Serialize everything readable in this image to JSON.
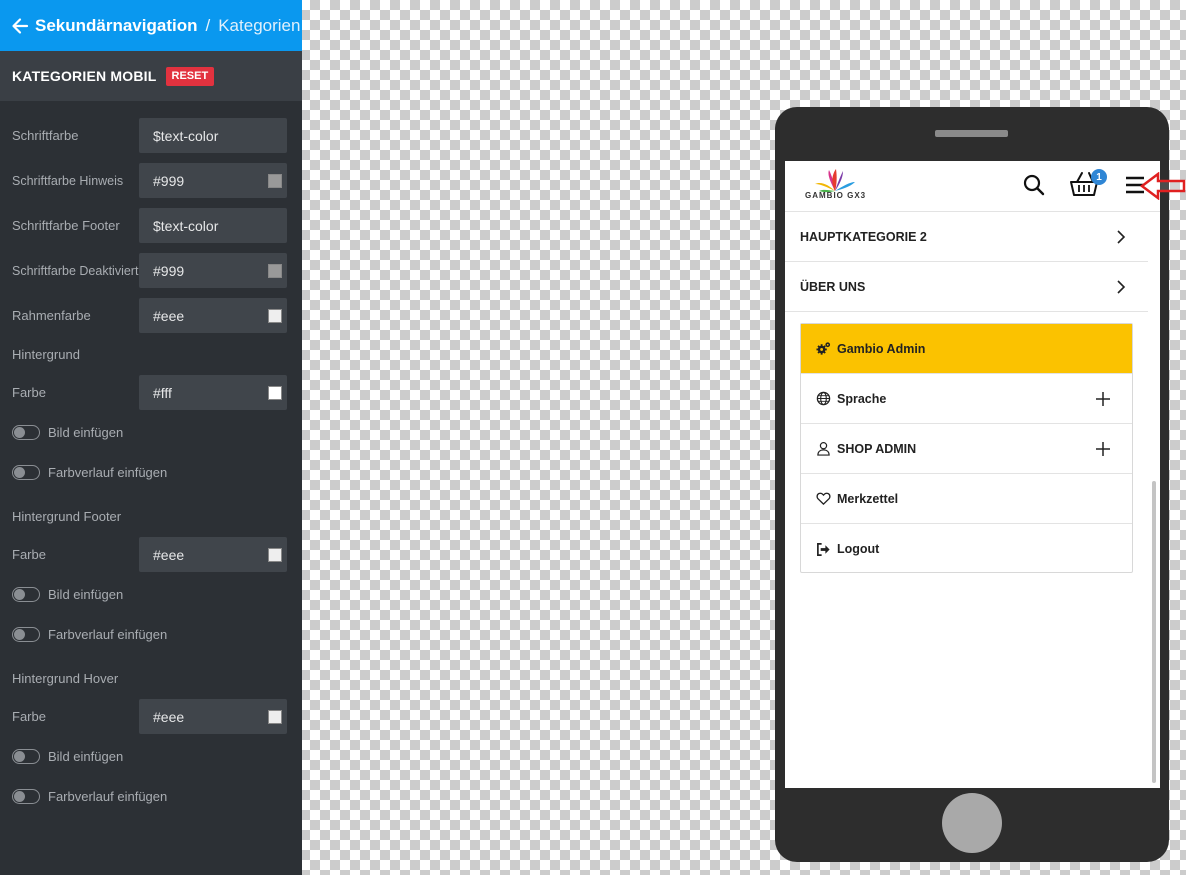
{
  "header": {
    "current": "Sekundärnavigation",
    "separator": "/",
    "next": "Kategorien"
  },
  "section": {
    "title": "KATEGORIEN MOBIL",
    "reset_label": "RESET"
  },
  "fields": {
    "schriftfarbe": {
      "label": "Schriftfarbe",
      "value": "$text-color"
    },
    "schriftfarbe_hinweis": {
      "label": "Schriftfarbe Hinweis",
      "value": "#999",
      "swatch": "#999999"
    },
    "schriftfarbe_footer": {
      "label": "Schriftfarbe Footer",
      "value": "$text-color"
    },
    "schriftfarbe_deaktiviert": {
      "label": "Schriftfarbe Deaktiviert",
      "value": "#999",
      "swatch": "#999999"
    },
    "rahmenfarbe": {
      "label": "Rahmenfarbe",
      "value": "#eee",
      "swatch": "#eeeeee"
    }
  },
  "hintergrund": {
    "title": "Hintergrund",
    "farbe_label": "Farbe",
    "farbe_value": "#fff",
    "swatch": "#ffffff",
    "bild_label": "Bild einfügen",
    "verlauf_label": "Farbverlauf einfügen"
  },
  "hintergrund_footer": {
    "title": "Hintergrund Footer",
    "farbe_label": "Farbe",
    "farbe_value": "#eee",
    "swatch": "#eeeeee",
    "bild_label": "Bild einfügen",
    "verlauf_label": "Farbverlauf einfügen"
  },
  "hintergrund_hover": {
    "title": "Hintergrund Hover",
    "farbe_label": "Farbe",
    "farbe_value": "#eee",
    "swatch": "#eeeeee",
    "bild_label": "Bild einfügen",
    "verlauf_label": "Farbverlauf einfügen"
  },
  "preview": {
    "logo_text": "GAMBIO GX3",
    "cart_count": "1",
    "categories": [
      "HAUPTKATEGORIE 2",
      "ÜBER UNS"
    ],
    "admin_items": [
      "Gambio Admin",
      "Sprache",
      "SHOP ADMIN",
      "Merkzettel",
      "Logout"
    ],
    "icons": [
      "search-icon",
      "cart-icon",
      "hamburger-menu-icon",
      "cogs-icon",
      "globe-icon",
      "user-icon",
      "heart-icon",
      "sign-out-icon"
    ],
    "highlight_color": "#fbc200"
  },
  "colors": {
    "header_bg": "#0a98ef",
    "panel_bg": "#2c3035",
    "reset_bg": "#e2323f",
    "annotation_arrow": "#e02020"
  }
}
